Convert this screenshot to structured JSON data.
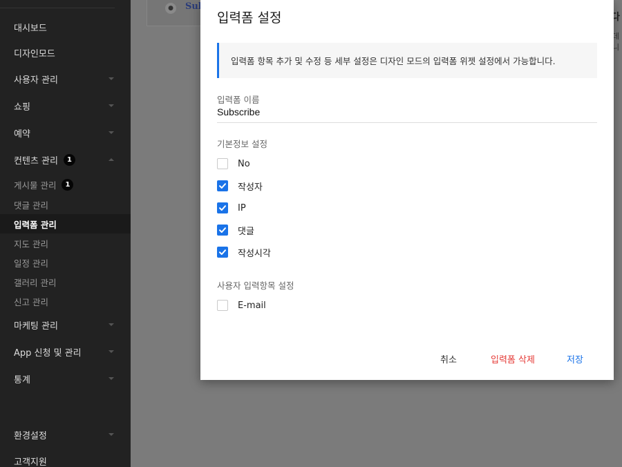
{
  "sidebar": {
    "items": [
      {
        "label": "대시보드",
        "type": "main"
      },
      {
        "label": "디자인모드",
        "type": "main"
      },
      {
        "label": "사용자 관리",
        "type": "main"
      },
      {
        "label": "쇼핑",
        "type": "main"
      },
      {
        "label": "예약",
        "type": "main"
      },
      {
        "label": "컨텐츠 관리",
        "type": "main",
        "badge": "1"
      },
      {
        "label": "게시물 관리",
        "type": "sub",
        "badge": "1"
      },
      {
        "label": "댓글 관리",
        "type": "sub"
      },
      {
        "label": "입력폼 관리",
        "type": "sub",
        "active": true
      },
      {
        "label": "지도 관리",
        "type": "sub"
      },
      {
        "label": "일정 관리",
        "type": "sub"
      },
      {
        "label": "갤러리 관리",
        "type": "sub"
      },
      {
        "label": "신고 관리",
        "type": "sub"
      },
      {
        "label": "마케팅 관리",
        "type": "main"
      },
      {
        "label": "App 신청 및 관리",
        "type": "main"
      },
      {
        "label": "통계",
        "type": "main"
      },
      {
        "label": "환경설정",
        "type": "main"
      },
      {
        "label": "고객지원",
        "type": "main"
      }
    ]
  },
  "background": {
    "card_text": "Sub",
    "right_text_1": "다",
    "right_text_2": "데니"
  },
  "modal": {
    "title": "입력폼 설정",
    "info": "입력폼 항목 추가 및 수정 등 세부 설정은 디자인 모드의 입력폼 위젯 설정에서 가능합니다.",
    "form_name_label": "입력폼 이름",
    "form_name_value": "Subscribe",
    "basic_section_label": "기본정보 설정",
    "basic_options": [
      {
        "label": "No",
        "checked": false
      },
      {
        "label": "작성자",
        "checked": true
      },
      {
        "label": "IP",
        "checked": true
      },
      {
        "label": "댓글",
        "checked": true
      },
      {
        "label": "작성시각",
        "checked": true
      }
    ],
    "user_section_label": "사용자 입력항목 설정",
    "user_options": [
      {
        "label": "E-mail",
        "checked": false
      }
    ],
    "buttons": {
      "cancel": "취소",
      "delete": "입력폼 삭제",
      "save": "저장"
    },
    "colors": {
      "accent": "#1a73e8",
      "danger": "#e53935"
    }
  }
}
